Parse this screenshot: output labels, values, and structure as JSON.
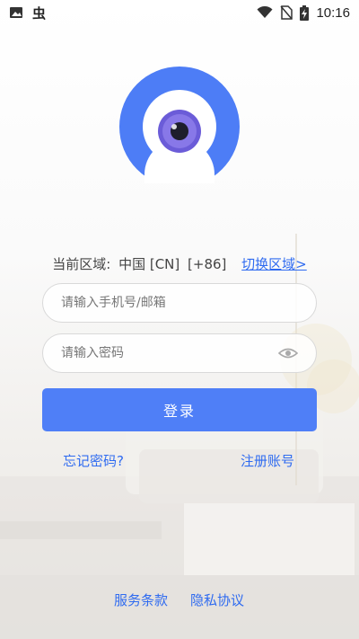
{
  "status_bar": {
    "time": "10:16",
    "icons": [
      "image-icon",
      "bug-icon",
      "wifi-icon",
      "no-sim-icon",
      "battery-charging-icon"
    ]
  },
  "logo": {
    "icon": "eye-camera-logo",
    "colors": {
      "ring": "#4d7df6",
      "lens": "#6b5cd8",
      "pupil": "#1e1e2c"
    }
  },
  "region": {
    "label": "当前区域:",
    "country": "中国 [CN]",
    "code": "[+86]",
    "switch_label": "切换区域>"
  },
  "form": {
    "phone_placeholder": "请输入手机号/邮箱",
    "password_placeholder": "请输入密码",
    "password_toggle_icon": "eye-icon",
    "login_label": "登录",
    "forgot_label": "忘记密码?",
    "register_label": "注册账号"
  },
  "footer": {
    "terms_label": "服务条款",
    "privacy_label": "隐私协议"
  },
  "colors": {
    "accent": "#4f7ff7",
    "link": "#2f6bf0"
  }
}
